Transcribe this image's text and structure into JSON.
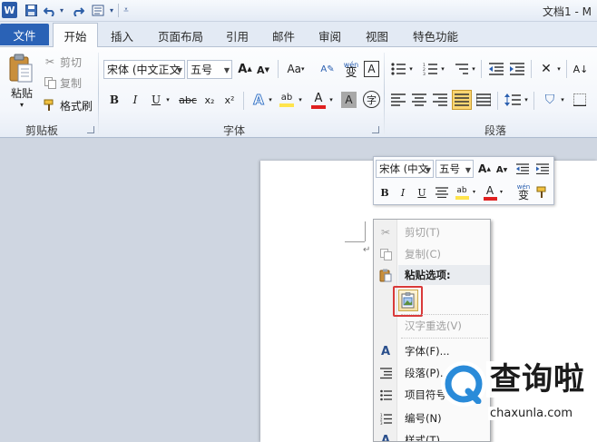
{
  "app": {
    "logo_letter": "W",
    "doc_title": "文档1 - M"
  },
  "tabs": [
    "文件",
    "开始",
    "插入",
    "页面布局",
    "引用",
    "邮件",
    "审阅",
    "视图",
    "特色功能"
  ],
  "clipboard": {
    "paste": "粘贴",
    "cut": "剪切",
    "copy": "复制",
    "format_painter": "格式刷",
    "group_label": "剪贴板"
  },
  "font": {
    "name": "宋体 (中文正文",
    "size": "五号",
    "case_button": "Aa",
    "phonetic_top": "wén",
    "phonetic_char": "变",
    "border_char": "A",
    "bold": "B",
    "italic": "I",
    "underline": "U",
    "strike": "abc",
    "subscript": "x₂",
    "superscript": "x²",
    "effects": "A",
    "highlight": "ab",
    "font_color": "A",
    "shade_char": "A",
    "enclose_char": "字",
    "group_label": "字体"
  },
  "paragraph": {
    "group_label": "段落"
  },
  "mini_toolbar": {
    "font": "宋体 (中文",
    "size": "五号",
    "bold": "B",
    "italic": "I",
    "underline": "U",
    "highlight": "ab",
    "font_color": "A",
    "phonetic_top": "wén",
    "phonetic_char": "变"
  },
  "context_menu": {
    "cut": "剪切(T)",
    "copy": "复制(C)",
    "paste_options": "粘贴选项:",
    "reconvert": "汉字重选(V)",
    "font": "字体(F)...",
    "paragraph": "段落(P)...",
    "bullets": "项目符号",
    "numbering": "编号(N)",
    "styles": "样式(T)"
  },
  "watermark": {
    "brand": "查询啦",
    "domain": "chaxunla.com"
  },
  "colors": {
    "file_tab": "#2a62b6",
    "highlight_yellow": "#ffe44d",
    "font_red": "#e02020",
    "paste_box_border": "#d93a3a",
    "watermark_blue": "#2a8bd9"
  }
}
